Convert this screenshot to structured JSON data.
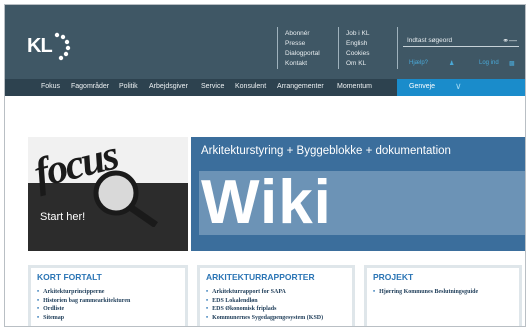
{
  "logo": {
    "text": "KL"
  },
  "util_col1": [
    "Abonnér",
    "Presse",
    "Dialogportal",
    "Kontakt"
  ],
  "util_col2": [
    "Job i KL",
    "English",
    "Cookies",
    "Om KL"
  ],
  "search": {
    "placeholder": "Indtast søgeord",
    "icon": "key-search-icon"
  },
  "login": {
    "help": "Hjælp?",
    "login": "Log ind"
  },
  "nav": {
    "items": [
      "Fokus",
      "Fagområder",
      "Politik",
      "Arbejdsgiver",
      "Service",
      "Konsulent",
      "Arrangementer",
      "Momentum"
    ],
    "genveje": "Genveje"
  },
  "focus": {
    "word": "focus",
    "start": "Start her!"
  },
  "wiki": {
    "title": "Arkitekturstyring + Byggeblokke + dokumentation",
    "big": "Wiki"
  },
  "boxes": [
    {
      "title": "KORT FORTALT",
      "items": [
        "Arkitekturprincipperne",
        "Historien bag rammearkitekturen",
        "Ordliste",
        "Sitemap"
      ]
    },
    {
      "title": "ARKITEKTURRAPPORTER",
      "items": [
        "Arkitekturrapport for SAPA",
        "EDS Lokalendløn",
        "EDS Økonomisk friplads",
        "Kommunernes Sygedagpengesystem (KSD)"
      ]
    },
    {
      "title": "PROJEKT",
      "items": [
        "Hjørring Kommunes Beslutningsguide"
      ]
    }
  ],
  "colors": {
    "header": "#3f5765",
    "nav": "#2d424f",
    "accent": "#1a8ccb",
    "wiki": "#3b6e9c",
    "box_title": "#2b75b5"
  }
}
